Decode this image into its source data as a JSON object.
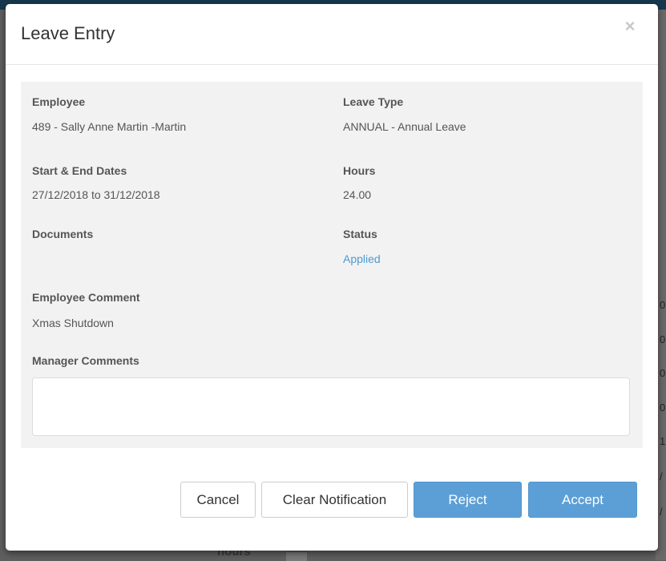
{
  "background": {
    "right_edge_chars": [
      "0",
      "0",
      "0",
      "0",
      "1",
      "/",
      "/"
    ],
    "bottom_text": "hours"
  },
  "modal": {
    "title": "Leave Entry",
    "close_symbol": "×"
  },
  "fields": {
    "employee_label": "Employee",
    "employee_value": "489 - Sally Anne Martin -Martin",
    "leave_type_label": "Leave Type",
    "leave_type_value": "ANNUAL - Annual Leave",
    "dates_label": "Start & End Dates",
    "dates_value": "27/12/2018 to 31/12/2018",
    "hours_label": "Hours",
    "hours_value": "24.00",
    "documents_label": "Documents",
    "documents_value": "",
    "status_label": "Status",
    "status_value": "Applied",
    "employee_comment_label": "Employee Comment",
    "employee_comment_value": "Xmas Shutdown",
    "manager_comments_label": "Manager Comments",
    "manager_comments_value": "",
    "manager_comments_placeholder": ""
  },
  "buttons": {
    "cancel": "Cancel",
    "clear_notification": "Clear Notification",
    "reject": "Reject",
    "accept": "Accept"
  },
  "colors": {
    "primary_button": "#5c9fd6",
    "status_link": "#4a9ad4",
    "header_bar": "#16384f"
  }
}
